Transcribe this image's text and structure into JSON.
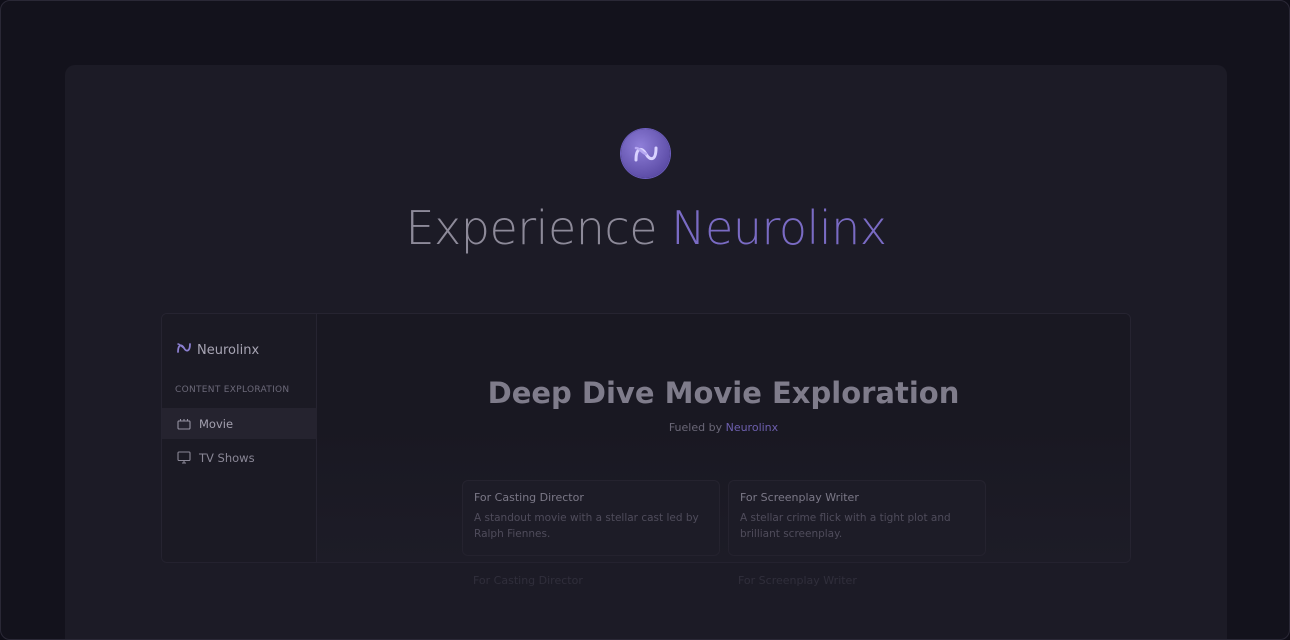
{
  "hero": {
    "title_prefix": "Experience ",
    "title_accent": "Neurolinx"
  },
  "sidebar": {
    "brand": "Neurolinx",
    "section_label": "CONTENT EXPLORATION",
    "items": [
      {
        "label": "Movie",
        "icon": "clapperboard-icon",
        "active": true
      },
      {
        "label": "TV Shows",
        "icon": "tv-icon",
        "active": false
      }
    ]
  },
  "main": {
    "title": "Deep Dive Movie Exploration",
    "subtitle_prefix": "Fueled by ",
    "subtitle_accent": "Neurolinx",
    "cards": [
      {
        "title": "For Casting Director",
        "desc": "A standout movie with a stellar cast led by Ralph Fiennes."
      },
      {
        "title": "For Screenplay Writer",
        "desc": "A stellar crime flick with a tight plot and brilliant screenplay."
      }
    ],
    "ghost_cards": [
      "For Casting Director",
      "For Screenplay Writer"
    ]
  },
  "colors": {
    "accent": "#7a6bc4",
    "background": "#13121c",
    "panel": "#1c1b26"
  }
}
